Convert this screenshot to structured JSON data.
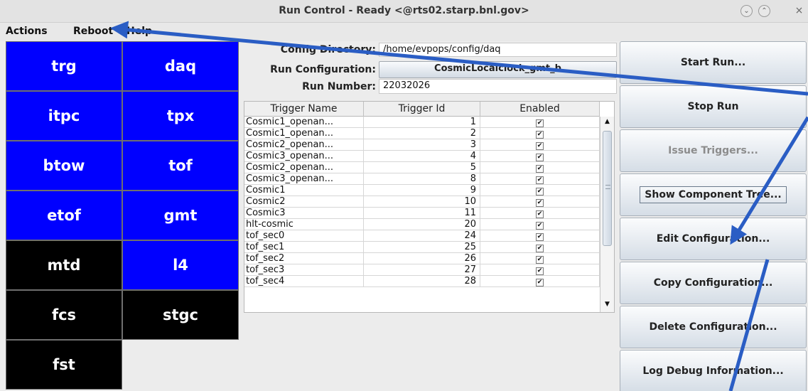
{
  "window": {
    "title": "Run Control - Ready <@rts02.starp.bnl.gov>",
    "min_symbol": "⌄",
    "max_symbol": "⌃",
    "close_symbol": "×"
  },
  "menu": [
    "Actions",
    "Reboot",
    "Help"
  ],
  "components": [
    {
      "label": "trg",
      "color": "blue"
    },
    {
      "label": "daq",
      "color": "blue"
    },
    {
      "label": "itpc",
      "color": "blue"
    },
    {
      "label": "tpx",
      "color": "blue"
    },
    {
      "label": "btow",
      "color": "blue"
    },
    {
      "label": "tof",
      "color": "blue"
    },
    {
      "label": "etof",
      "color": "blue"
    },
    {
      "label": "gmt",
      "color": "blue"
    },
    {
      "label": "mtd",
      "color": "black"
    },
    {
      "label": "l4",
      "color": "blue"
    },
    {
      "label": "fcs",
      "color": "black"
    },
    {
      "label": "stgc",
      "color": "black"
    },
    {
      "label": "fst",
      "color": "black"
    }
  ],
  "config": {
    "dir_label": "Config Directory:",
    "dir_value": "/home/evpops/config/daq",
    "run_config_label": "Run Configuration:",
    "run_config_value": "CosmicLocalclock_gmt_b",
    "run_number_label": "Run Number:",
    "run_number_value": "22032026"
  },
  "table": {
    "headers": [
      "Trigger Name",
      "Trigger Id",
      "Enabled"
    ],
    "rows": [
      {
        "name": "Cosmic1_openan...",
        "id": "1",
        "enabled": true
      },
      {
        "name": "Cosmic1_openan...",
        "id": "2",
        "enabled": true
      },
      {
        "name": "Cosmic2_openan...",
        "id": "3",
        "enabled": true
      },
      {
        "name": "Cosmic3_openan...",
        "id": "4",
        "enabled": true
      },
      {
        "name": "Cosmic2_openan...",
        "id": "5",
        "enabled": true
      },
      {
        "name": "Cosmic3_openan...",
        "id": "8",
        "enabled": true
      },
      {
        "name": "Cosmic1",
        "id": "9",
        "enabled": true
      },
      {
        "name": "Cosmic2",
        "id": "10",
        "enabled": true
      },
      {
        "name": "Cosmic3",
        "id": "11",
        "enabled": true
      },
      {
        "name": "hlt-cosmic",
        "id": "20",
        "enabled": true
      },
      {
        "name": "tof_sec0",
        "id": "24",
        "enabled": true
      },
      {
        "name": "tof_sec1",
        "id": "25",
        "enabled": true
      },
      {
        "name": "tof_sec2",
        "id": "26",
        "enabled": true
      },
      {
        "name": "tof_sec3",
        "id": "27",
        "enabled": true
      },
      {
        "name": "tof_sec4",
        "id": "28",
        "enabled": true
      }
    ],
    "check_mark": "✔",
    "scroll_up": "▲",
    "scroll_down": "▼"
  },
  "buttons": [
    {
      "label": "Start Run...",
      "enabled": true
    },
    {
      "label": "Stop Run",
      "enabled": true
    },
    {
      "label": "Issue Triggers...",
      "enabled": false
    },
    {
      "label": "Show Component Tree...",
      "enabled": true,
      "focused": true
    },
    {
      "label": "Edit Configuration...",
      "enabled": true
    },
    {
      "label": "Copy Configuration...",
      "enabled": true
    },
    {
      "label": "Delete Configuration...",
      "enabled": true
    },
    {
      "label": "Log Debug Information...",
      "enabled": true
    }
  ],
  "colors": {
    "component_on": "#0000ff",
    "component_off": "#000000",
    "arrow": "#2a5dc4"
  }
}
